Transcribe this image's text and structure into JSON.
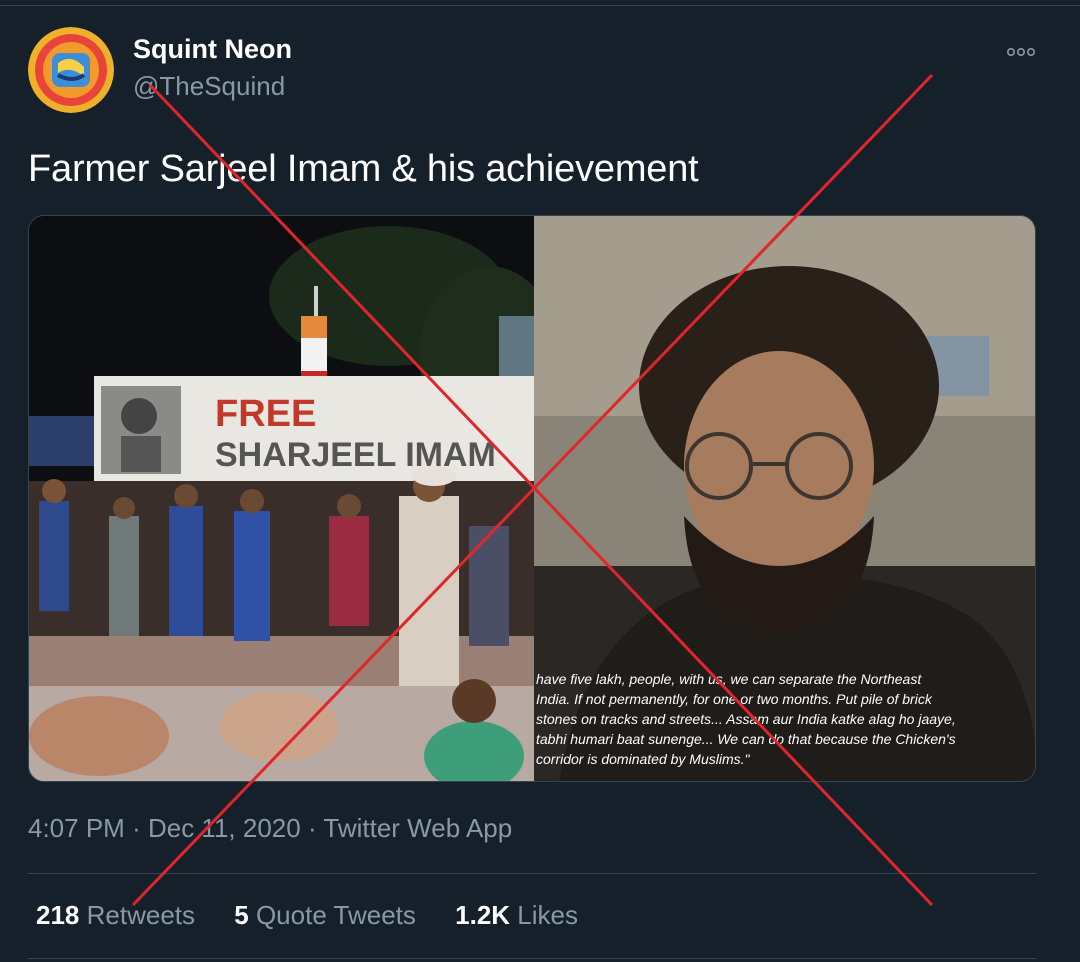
{
  "tweet": {
    "display_name": "Squint Neon",
    "handle": "@TheSquind",
    "text": "Farmer Sarjeel Imam & his achievement",
    "time": "4:07 PM",
    "date": "Dec 11, 2020",
    "source": "Twitter Web App",
    "separator": "·"
  },
  "media": {
    "left_banner_line1": "FREE",
    "left_banner_line2": "SHARJEEL IMAM",
    "caption_lines": [
      "have five lakh, people, with us, we can separate the Northeast",
      "India. If not permanently, for one or two months. Put pile of brick",
      "stones on tracks and streets... Assam aur India katke alag ho jaaye,",
      "tabhi humari baat sunenge... We can do that because the Chicken's",
      "corridor  is dominated by Muslims.\""
    ]
  },
  "stats": {
    "retweets_count": "218",
    "retweets_label": "Retweets",
    "quotes_count": "5",
    "quotes_label": "Quote Tweets",
    "likes_count": "1.2K",
    "likes_label": "Likes"
  },
  "colors": {
    "background": "#15202b",
    "secondary_text": "#8899a6",
    "border": "#38444d",
    "cross_mark": "#e0262b"
  },
  "icons": {
    "more": "more-horizontal-icon",
    "avatar": "squint-neon-logo"
  }
}
